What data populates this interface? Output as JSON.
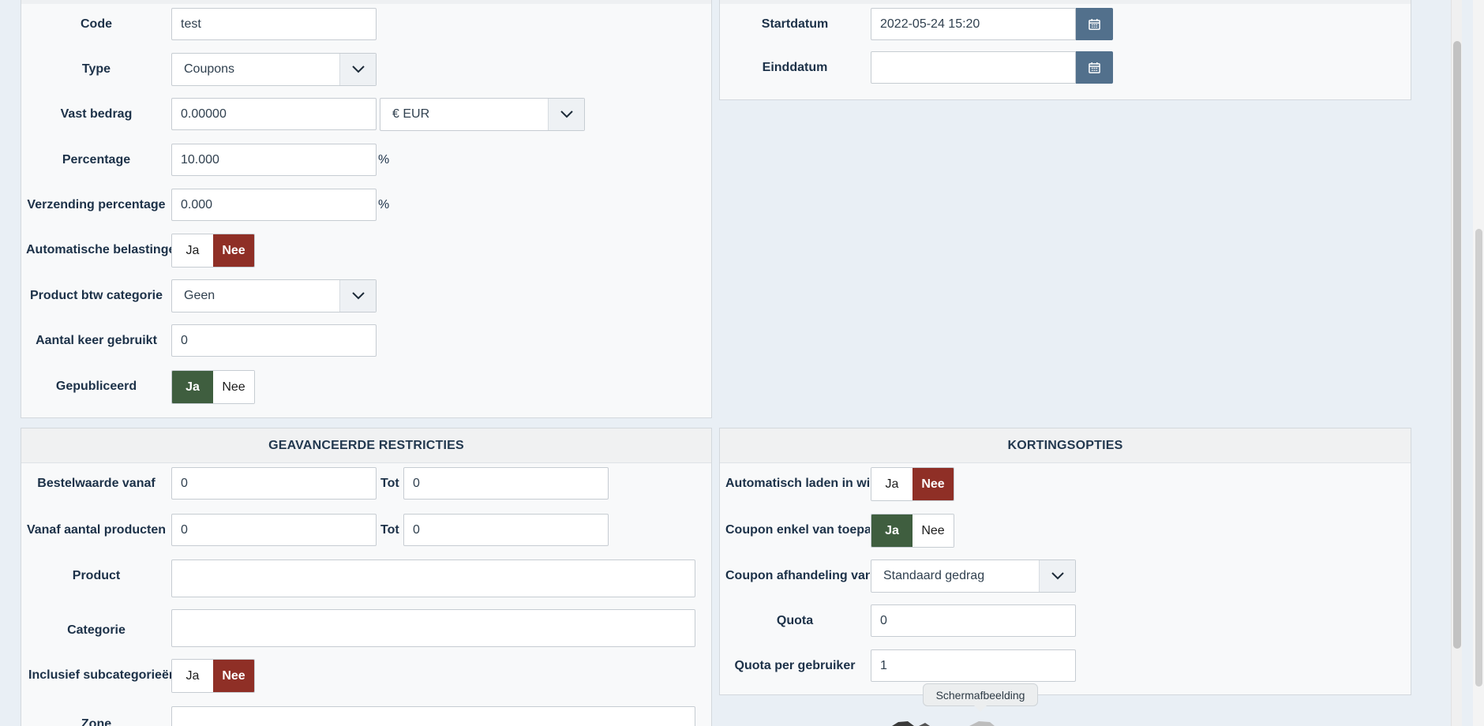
{
  "main_form": {
    "code": {
      "label": "Code",
      "value": "test"
    },
    "type": {
      "label": "Type",
      "value": "Coupons"
    },
    "vast_bedrag": {
      "label": "Vast bedrag",
      "value": "0.00000",
      "currency": "€ EUR"
    },
    "percentage": {
      "label": "Percentage",
      "value": "10.000",
      "unit": "%"
    },
    "verzending_percentage": {
      "label": "Verzending percentage",
      "value": "0.000",
      "unit": "%"
    },
    "automatische_belastingen": {
      "label": "Automatische belastingen",
      "yes": "Ja",
      "no": "Nee",
      "selected": "no"
    },
    "product_btw_categorie": {
      "label": "Product btw categorie",
      "value": "Geen"
    },
    "aantal_keer_gebruikt": {
      "label": "Aantal keer gebruikt",
      "value": "0"
    },
    "gepubliceerd": {
      "label": "Gepubliceerd",
      "yes": "Ja",
      "no": "Nee",
      "selected": "yes"
    }
  },
  "dates": {
    "startdatum": {
      "label": "Startdatum",
      "value": "2022-05-24 15:20"
    },
    "einddatum": {
      "label": "Einddatum",
      "value": ""
    }
  },
  "restrictions": {
    "title": "GEAVANCEERDE RESTRICTIES",
    "bestelwaarde": {
      "label": "Bestelwaarde vanaf",
      "from": "0",
      "to_label": "Tot",
      "to": "0"
    },
    "aantal_producten": {
      "label": "Vanaf aantal producten",
      "from": "0",
      "to_label": "Tot",
      "to": "0"
    },
    "product": {
      "label": "Product",
      "value": ""
    },
    "categorie": {
      "label": "Categorie",
      "value": ""
    },
    "inclusief_subcategorieen": {
      "label": "Inclusief subcategorieën",
      "yes": "Ja",
      "no": "Nee",
      "selected": "no"
    },
    "zone": {
      "label": "Zone",
      "value": ""
    }
  },
  "discount_options": {
    "title": "KORTINGSOPTIES",
    "automatisch_laden": {
      "label": "Automatisch laden in winkelwagen",
      "yes": "Ja",
      "no": "Nee",
      "selected": "no"
    },
    "coupon_enkel": {
      "label": "Coupon enkel van toepassing",
      "yes": "Ja",
      "no": "Nee",
      "selected": "yes"
    },
    "coupon_afhandeling": {
      "label": "Coupon afhandeling van producten",
      "value": "Standaard gedrag"
    },
    "quota": {
      "label": "Quota",
      "value": "0"
    },
    "quota_per_gebruiker": {
      "label": "Quota per gebruiker",
      "value": "1"
    }
  },
  "tooltip": {
    "text": "Schermafbeelding"
  },
  "colors": {
    "no_active": "#8f2f26",
    "yes_active": "#3f5e3f",
    "calendar_button": "#52708c"
  }
}
